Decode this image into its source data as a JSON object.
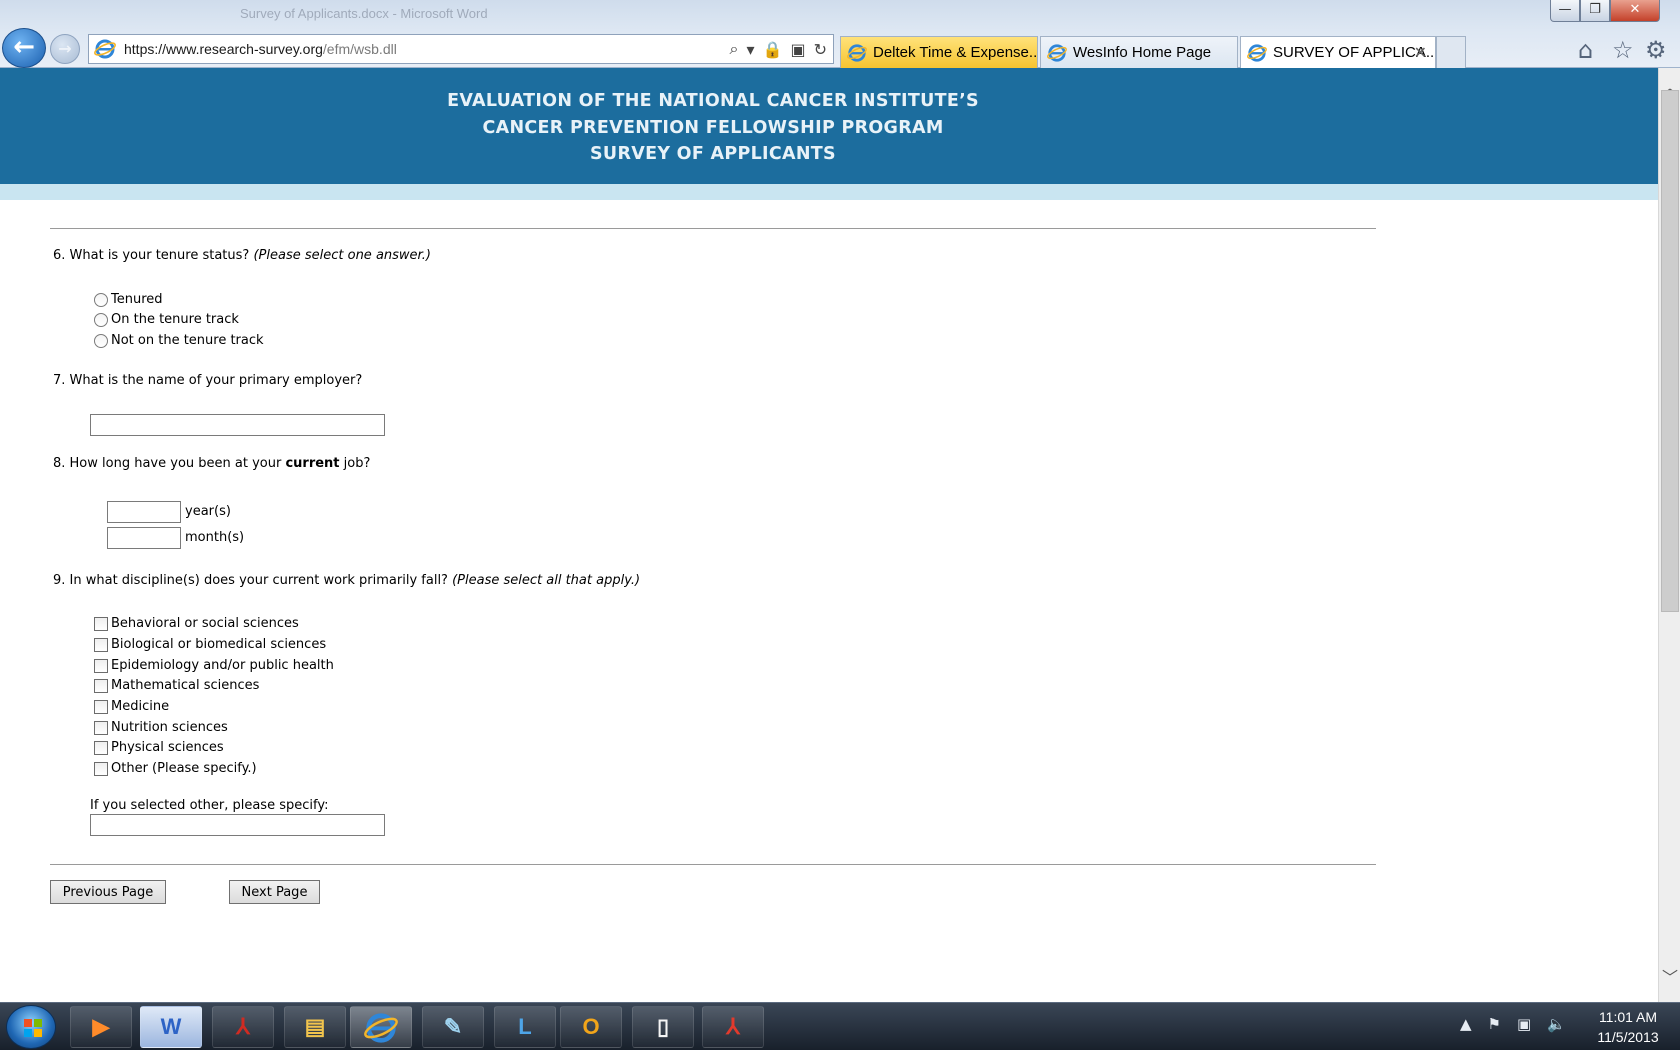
{
  "window": {
    "ghost_title": "Survey of Applicants.docx - Microsoft Word",
    "min": "—",
    "max": "❐",
    "close": "✕"
  },
  "nav": {
    "back": "←",
    "forward": "→"
  },
  "address": {
    "url_main": "https://www.research-survey.org",
    "url_dim": "/efm/wsb.dll",
    "tools": [
      "⌕",
      "▾",
      "🔒",
      "▣",
      "↻"
    ]
  },
  "tabs": [
    {
      "label": "Deltek Time & Expense...",
      "active": false
    },
    {
      "label": "WesInfo Home Page",
      "active": false
    },
    {
      "label": "SURVEY OF APPLICA...",
      "active": true
    }
  ],
  "tab_close": "✕",
  "toolbar_icons": {
    "home": "⌂",
    "favorites": "☆",
    "tools": "⚙"
  },
  "banner": {
    "line1": "EVALUATION OF THE NATIONAL CANCER INSTITUTE’S",
    "line2": "CANCER PREVENTION FELLOWSHIP PROGRAM",
    "line3": "SURVEY OF APPLICANTS"
  },
  "colors": {
    "banner_bg": "#1c6d9e",
    "banner_strip": "#c9e5f1",
    "active_tab": "#ffffff",
    "deltek_tab": "#f6c430"
  },
  "q6": {
    "text": "6. What is your tenure status?",
    "hint": "(Please select one answer.)",
    "options": [
      "Tenured",
      "On the tenure track",
      "Not on the tenure track"
    ]
  },
  "q7": {
    "text": "7. What is the name of your primary employer?",
    "value": ""
  },
  "q8": {
    "text_before": "8. How long have you been at your ",
    "text_bold": "current",
    "text_after": " job?",
    "years_label": "year(s)",
    "months_label": "month(s)"
  },
  "q9": {
    "text": "9. In what discipline(s) does your current work primarily fall?",
    "hint": "(Please select all that apply.)",
    "options": [
      "Behavioral or social sciences",
      "Biological or biomedical sciences",
      "Epidemiology and/or public health",
      "Mathematical sciences",
      "Medicine",
      "Nutrition sciences",
      "Physical sciences",
      "Other (Please specify.)"
    ],
    "other_label": "If you selected other, please specify:"
  },
  "buttons": {
    "previous": "Previous Page",
    "next": "Next Page"
  },
  "scroll": {
    "up": "︿",
    "down": "﹀"
  },
  "taskbar": {
    "apps": {
      "media": "▶",
      "word": "W",
      "reader": "⅄",
      "explorer": "▤",
      "note": "✎",
      "lync": "L",
      "outlook": "O",
      "file": "▯",
      "acrobat": "⅄"
    },
    "tray": [
      "▲",
      "⚑",
      "▣",
      "🔈"
    ],
    "time": "11:01 AM",
    "date": "11/5/2013"
  }
}
